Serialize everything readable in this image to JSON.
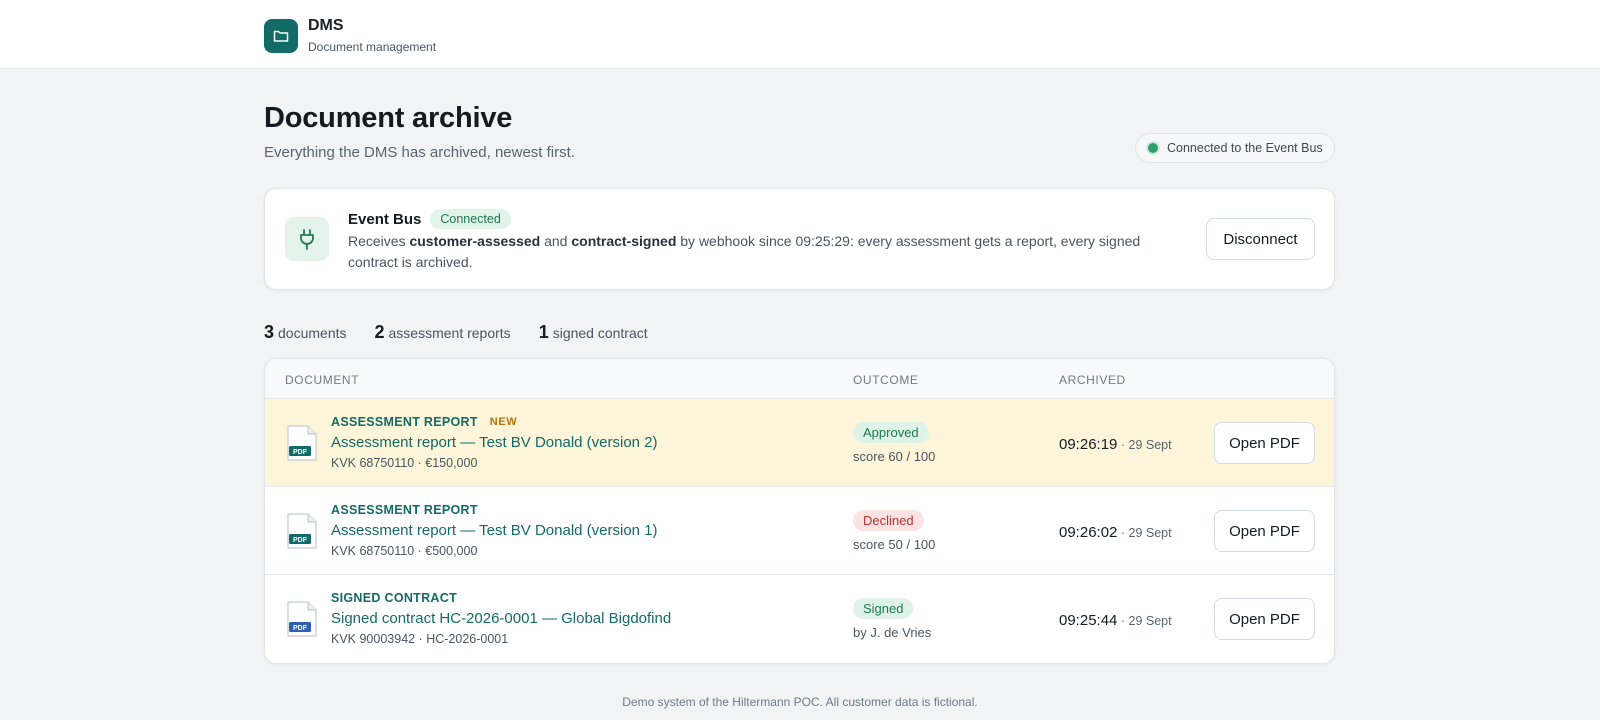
{
  "app": {
    "name": "DMS",
    "subtitle": "Document management"
  },
  "page": {
    "title": "Document archive",
    "subtitle": "Everything the DMS has archived, newest first.",
    "status": "Connected to the Event Bus"
  },
  "event_bus": {
    "title": "Event Bus",
    "badge": "Connected",
    "desc_prefix": "Receives ",
    "event_1": "customer-assessed",
    "desc_and": " and ",
    "event_2": "contract-signed",
    "desc_suffix": " by webhook since 09:25:29: every assessment gets a report, every signed contract is archived.",
    "button": "Disconnect"
  },
  "counters": [
    {
      "count": "3",
      "label": "documents"
    },
    {
      "count": "2",
      "label": "assessment reports"
    },
    {
      "count": "1",
      "label": "signed contract"
    }
  ],
  "table": {
    "columns": [
      "DOCUMENT",
      "OUTCOME",
      "ARCHIVED"
    ],
    "rows": [
      {
        "type": "ASSESSMENT REPORT",
        "new_tag": "NEW",
        "title": "Assessment report — Test BV Donald (version 2)",
        "meta": "KVK 68750110 · €150,000",
        "outcome": "Approved",
        "outcome_sub": "score 60 / 100",
        "time": "09:26:19",
        "date": " · 29 Sept",
        "button": "Open PDF"
      },
      {
        "type": "ASSESSMENT REPORT",
        "title": "Assessment report — Test BV Donald (version 1)",
        "meta": "KVK 68750110 · €500,000",
        "outcome": "Declined",
        "outcome_sub": "score 50 / 100",
        "time": "09:26:02",
        "date": " · 29 Sept",
        "button": "Open PDF"
      },
      {
        "type": "SIGNED CONTRACT",
        "title": "Signed contract HC-2026-0001 — Global Bigdofind",
        "meta": "KVK 90003942 · HC-2026-0001",
        "outcome": "Signed",
        "outcome_sub": "by J. de Vries",
        "time": "09:25:44",
        "date": " · 29 Sept",
        "button": "Open PDF"
      }
    ]
  },
  "footer": "Demo system of the Hiltermann POC. All customer data is fictional.",
  "icons": {
    "brand": "folder-icon",
    "event_bus": "plug-icon",
    "document": "pdf-file-icon"
  },
  "colors": {
    "brand": "#136b68",
    "accent_text": "#146a66",
    "highlight_row": "#fdf5d9",
    "approved": "#1f7a52",
    "declined": "#b53434",
    "pdf_report": "#136b68",
    "pdf_contract": "#2f5fb3"
  }
}
